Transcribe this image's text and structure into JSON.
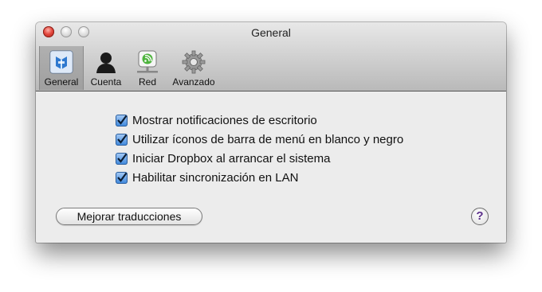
{
  "window": {
    "title": "General"
  },
  "toolbar": {
    "tabs": [
      {
        "label": "General",
        "icon": "dropbox-general-icon",
        "selected": true
      },
      {
        "label": "Cuenta",
        "icon": "account-person-icon",
        "selected": false
      },
      {
        "label": "Red",
        "icon": "network-icon",
        "selected": false
      },
      {
        "label": "Avanzado",
        "icon": "gear-icon",
        "selected": false
      }
    ]
  },
  "options": [
    {
      "label": "Mostrar notificaciones de escritorio",
      "checked": true
    },
    {
      "label": "Utilizar íconos de barra de menú en blanco y negro",
      "checked": true
    },
    {
      "label": "Iniciar Dropbox al arrancar el sistema",
      "checked": true
    },
    {
      "label": "Habilitar sincronización en LAN",
      "checked": true
    }
  ],
  "buttons": {
    "improve_translations": "Mejorar traducciones",
    "help": "?"
  },
  "colors": {
    "checkbox_blue": "#3b86dc",
    "close_red": "#e2463c",
    "help_purple": "#5a2d8a"
  }
}
